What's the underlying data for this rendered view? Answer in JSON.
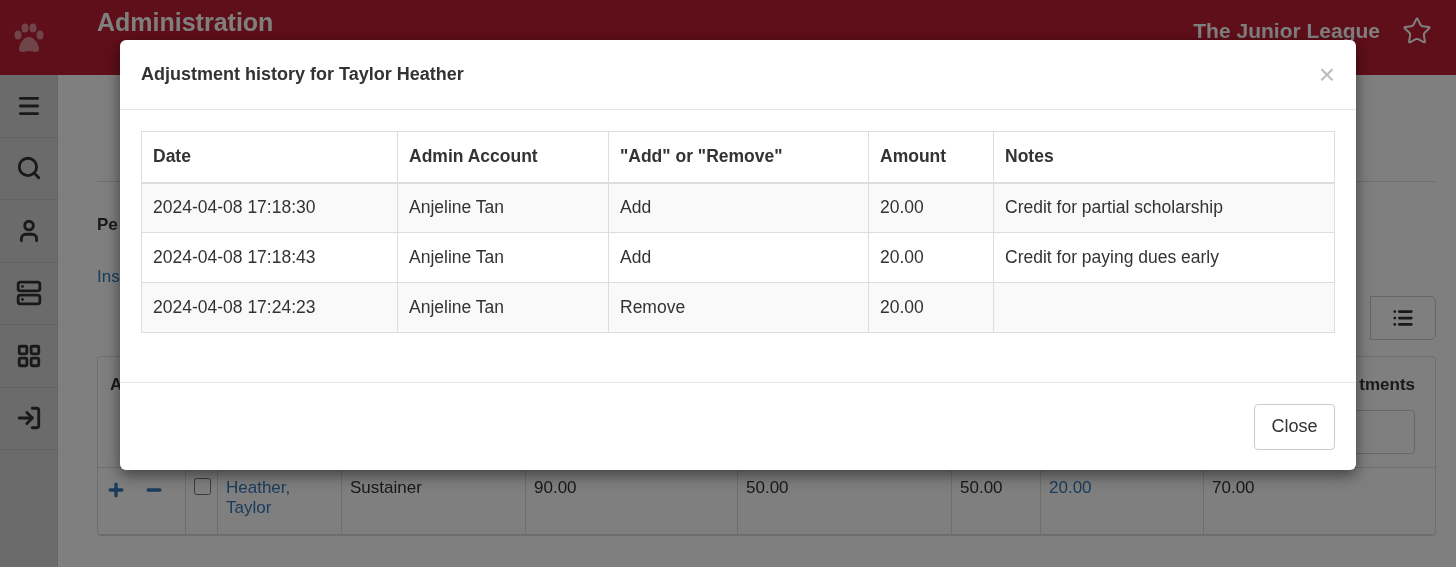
{
  "header": {
    "title": "Administration",
    "organization": "The Junior League"
  },
  "page": {
    "heading": "Pe",
    "link": "Ins",
    "table": {
      "first_column": "A",
      "last_column": "tments",
      "rows": [
        {
          "checked": false,
          "name": "Heather, Taylor",
          "cells": [
            "Sustainer",
            "90.00",
            "50.00",
            "50.00"
          ],
          "adjustment": "20.00",
          "total": "70.00"
        }
      ]
    }
  },
  "modal": {
    "title": "Adjustment history for Taylor Heather",
    "close_icon": "×",
    "columns": [
      "Date",
      "Admin Account",
      "\"Add\" or \"Remove\"",
      "Amount",
      "Notes"
    ],
    "rows": [
      {
        "date": "2024-04-08 17:18:30",
        "admin": "Anjeline Tan",
        "action": "Add",
        "amount": "20.00",
        "notes": "Credit for partial scholarship"
      },
      {
        "date": "2024-04-08 17:18:43",
        "admin": "Anjeline Tan",
        "action": "Add",
        "amount": "20.00",
        "notes": "Credit for paying dues early"
      },
      {
        "date": "2024-04-08 17:24:23",
        "admin": "Anjeline Tan",
        "action": "Remove",
        "amount": "20.00"
      }
    ],
    "close_button": "Close"
  }
}
